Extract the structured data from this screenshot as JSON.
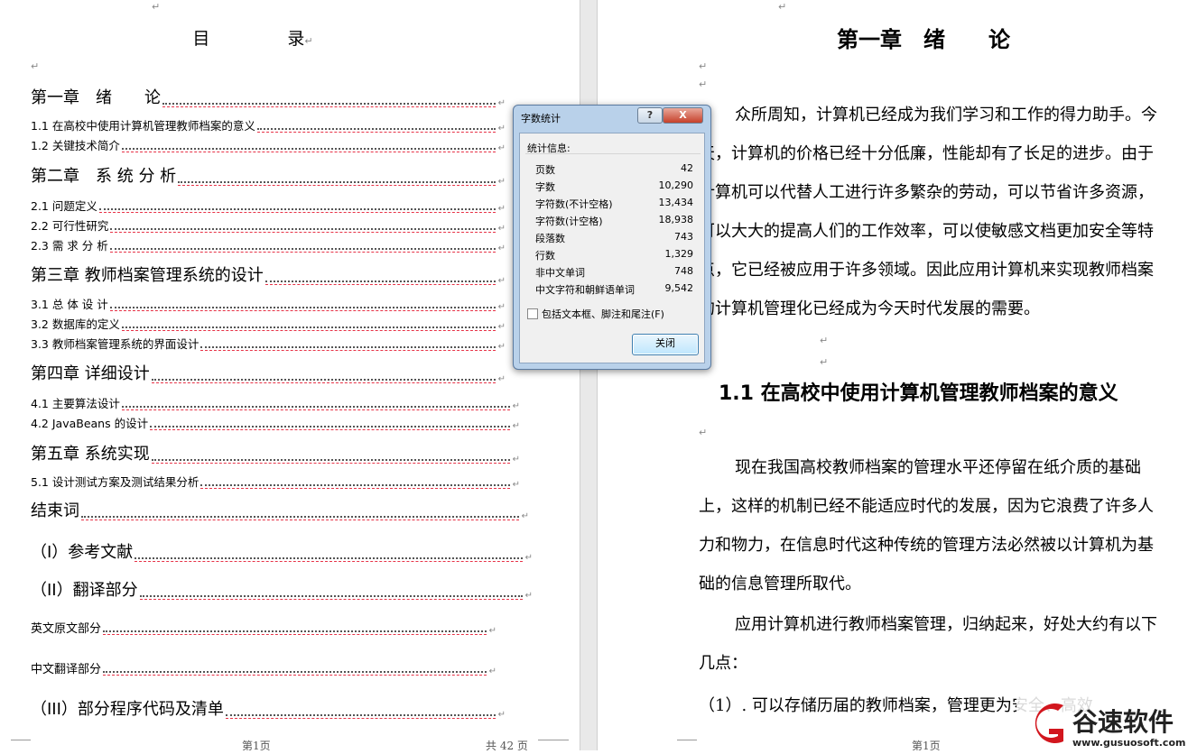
{
  "left_page": {
    "toc_title": [
      "目",
      "录"
    ],
    "entries": [
      {
        "text": "第一章　绪　　论",
        "level": "chapter"
      },
      {
        "text": "1.1  在高校中使用计算机管理教师档案的意义",
        "level": "section"
      },
      {
        "text": "1.2  关键技术简介",
        "level": "section"
      },
      {
        "text": "第二章　系 统 分 析",
        "level": "chapter"
      },
      {
        "text": "2.1  问题定义",
        "level": "section"
      },
      {
        "text": "2.2  可行性研究",
        "level": "section"
      },
      {
        "text": "2.3    需 求 分 析",
        "level": "section"
      },
      {
        "text": "第三章  教师档案管理系统的设计",
        "level": "chapter"
      },
      {
        "text": "3.1  总 体 设 计",
        "level": "section"
      },
      {
        "text": "3.2  数据库的定义",
        "level": "section"
      },
      {
        "text": "3.3  教师档案管理系统的界面设计",
        "level": "section"
      },
      {
        "text": "第四章  详细设计",
        "level": "chapter"
      },
      {
        "text": "4.1  主要算法设计",
        "level": "section"
      },
      {
        "text": "4.2    JavaBeans 的设计",
        "level": "section"
      },
      {
        "text": "第五章  系统实现",
        "level": "chapter"
      },
      {
        "text": "5.1  设计测试方案及测试结果分析",
        "level": "section"
      },
      {
        "text": "结束词",
        "level": "chapter"
      },
      {
        "text": "（I）参考文献",
        "level": "chapter"
      },
      {
        "text": "（II）翻译部分",
        "level": "chapter"
      },
      {
        "text": "英文原文部分",
        "level": "minor"
      },
      {
        "text": "中文翻译部分",
        "level": "minor"
      },
      {
        "text": "（III）部分程序代码及清单",
        "level": "chapter"
      }
    ],
    "footer_left": "第1页",
    "footer_right": "共 42 页"
  },
  "right_page": {
    "chapter_title": "第一章　绪　　论",
    "para1_lines": [
      "众所周知，计算机已经成为我们学习和工作的得力助手。今",
      "天，计算机的价格已经十分低廉，性能却有了长足的进步。由于",
      "计算机可以代替人工进行许多繁杂的劳动，可以节省许多资源，",
      "可以大大的提高人们的工作效率，可以使敏感文档更加安全等特",
      "点，它已经被应用于许多领域。因此应用计算机来实现教师档案",
      "的计算机管理化已经成为今天时代发展的需要。"
    ],
    "section_title": "1.1  在高校中使用计算机管理教师档案的意义",
    "para2_lines": [
      "现在我国高校教师档案的管理水平还停留在纸介质的基础",
      "上，这样的机制已经不能适应时代的发展，因为它浪费了许多人",
      "力和物力，在信息时代这种传统的管理方法必然被以计算机为基",
      "础的信息管理所取代。"
    ],
    "para3_lines": [
      "应用计算机进行教师档案管理，归纳起来，好处大约有以下",
      "几点："
    ],
    "list_item": "（1）.   可以存储历届的教师档案，管理更为安全、高效",
    "footer": "第1页"
  },
  "dialog": {
    "title": "字数统计",
    "help_label": "?",
    "close_x_label": "X",
    "group_label": "统计信息:",
    "stats": [
      {
        "label": "页数",
        "value": "42"
      },
      {
        "label": "字数",
        "value": "10,290"
      },
      {
        "label": "字符数(不计空格)",
        "value": "13,434"
      },
      {
        "label": "字符数(计空格)",
        "value": "18,938"
      },
      {
        "label": "段落数",
        "value": "743"
      },
      {
        "label": "行数",
        "value": "1,329"
      },
      {
        "label": "非中文单词",
        "value": "748"
      },
      {
        "label": "中文字符和朝鲜语单词",
        "value": "9,542"
      }
    ],
    "checkbox_label": "包括文本框、脚注和尾注(F)",
    "close_button": "关闭"
  },
  "watermark": {
    "brand": "谷速软件",
    "url": "www.gusuosoft.com",
    "colors": {
      "red": "#d2161e",
      "dark": "#222222"
    }
  }
}
